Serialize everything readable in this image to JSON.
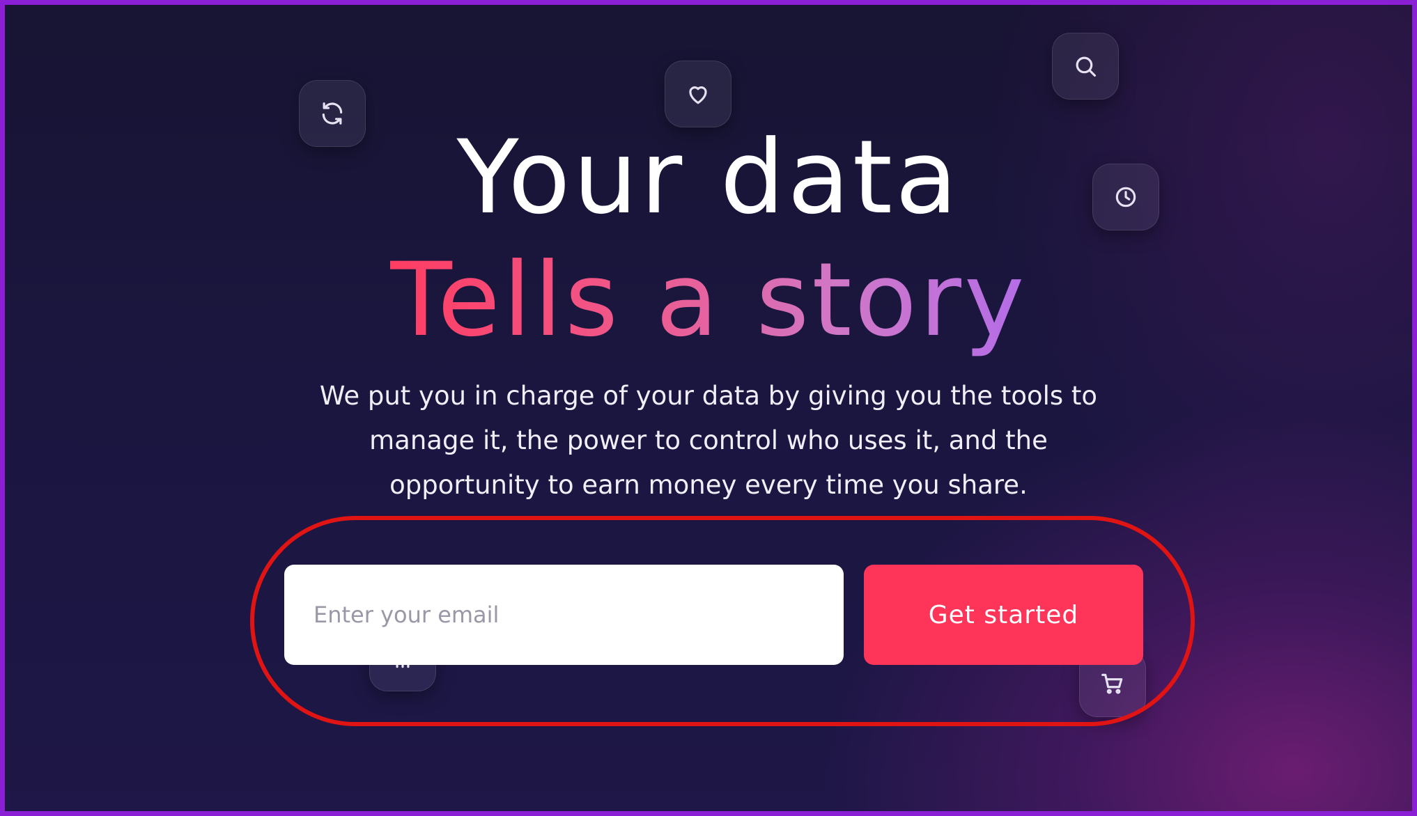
{
  "hero": {
    "headline_line1": "Your data",
    "headline_line2": "Tells a story",
    "description": "We put you in charge of your data by giving you the tools to manage it, the power to control who uses it, and the opportunity to earn money every time you share."
  },
  "signup": {
    "email_placeholder": "Enter your email",
    "email_value": "",
    "cta_label": "Get started"
  },
  "floating_icons": [
    "refresh-icon",
    "heart-icon",
    "search-icon",
    "clock-icon",
    "cart-icon",
    "chart-icon"
  ],
  "colors": {
    "background": "#1a1640",
    "frame_border": "#8a1fd6",
    "cta": "#ff3459",
    "gradient_start": "#ff3d62",
    "gradient_end": "#b46de8",
    "annotation_ring": "#e11414"
  }
}
